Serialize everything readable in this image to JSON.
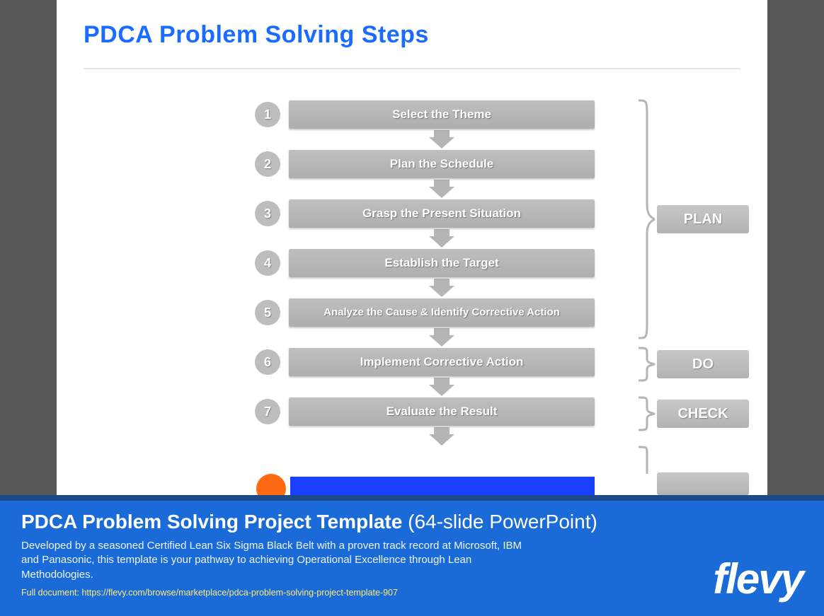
{
  "slide": {
    "title": "PDCA Problem Solving Steps",
    "steps": [
      {
        "num": "1",
        "label": "Select the Theme"
      },
      {
        "num": "2",
        "label": "Plan the Schedule"
      },
      {
        "num": "3",
        "label": "Grasp the Present Situation"
      },
      {
        "num": "4",
        "label": "Establish the Target"
      },
      {
        "num": "5",
        "label": "Analyze the Cause & Identify Corrective Action"
      },
      {
        "num": "6",
        "label": "Implement Corrective Action"
      },
      {
        "num": "7",
        "label": "Evaluate the Result"
      }
    ],
    "phases": [
      {
        "label": "PLAN"
      },
      {
        "label": "DO"
      },
      {
        "label": "CHECK"
      }
    ]
  },
  "banner": {
    "title_bold": "PDCA Problem Solving Project Template",
    "title_light": " (64-slide PowerPoint)",
    "description": "Developed by a seasoned Certified Lean Six Sigma Black Belt with a proven track record at Microsoft, IBM and Panasonic, this template is your pathway to achieving Operational Excellence through Lean Methodologies.",
    "link_text": "Full document: https://flevy.com/browse/marketplace/pdca-problem-solving-project-template-907",
    "logo": "flevy"
  }
}
